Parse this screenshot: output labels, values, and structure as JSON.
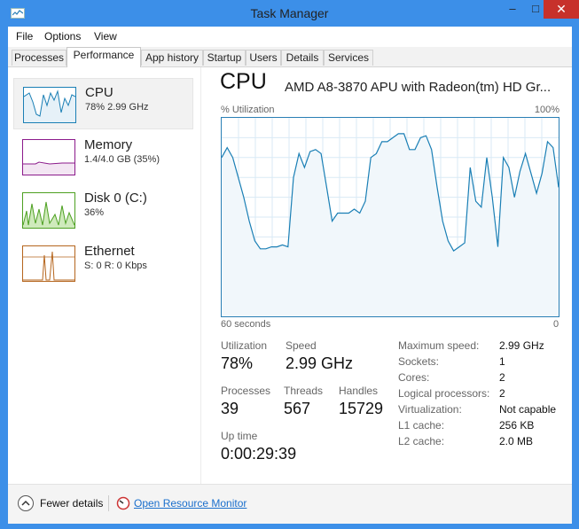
{
  "window": {
    "title": "Task Manager",
    "minimize": "–",
    "maximize": "□",
    "close": "✕"
  },
  "menu": [
    "File",
    "Options",
    "View"
  ],
  "tabs": [
    "Processes",
    "Performance",
    "App history",
    "Startup",
    "Users",
    "Details",
    "Services"
  ],
  "active_tab": "Performance",
  "sidebar": [
    {
      "title": "CPU",
      "sub": "78% 2.99 GHz",
      "color": "#1a7fb5"
    },
    {
      "title": "Memory",
      "sub": "1.4/4.0 GB (35%)",
      "color": "#8b1a8b"
    },
    {
      "title": "Disk 0 (C:)",
      "sub": "36%",
      "color": "#4da021"
    },
    {
      "title": "Ethernet",
      "sub": "S: 0 R: 0 Kbps",
      "color": "#b5651d"
    }
  ],
  "main": {
    "title": "CPU",
    "processor": "AMD A8-3870 APU with Radeon(tm) HD Gr...",
    "util_label": "% Utilization",
    "util_max": "100%",
    "time_label": "60 seconds",
    "time_zero": "0"
  },
  "chart_data": {
    "type": "area",
    "ylim": [
      0,
      100
    ],
    "x_range": [
      60,
      0
    ],
    "values": [
      80,
      85,
      80,
      70,
      60,
      48,
      38,
      34,
      34,
      35,
      35,
      36,
      35,
      70,
      82,
      75,
      83,
      84,
      82,
      65,
      48,
      52,
      52,
      52,
      54,
      52,
      58,
      80,
      82,
      88,
      88,
      90,
      92,
      92,
      84,
      84,
      90,
      91,
      84,
      65,
      48,
      38,
      33,
      35,
      37,
      75,
      58,
      55,
      80,
      60,
      35,
      80,
      75,
      60,
      73,
      82,
      72,
      62,
      72,
      88,
      85,
      65
    ],
    "grid": true
  },
  "stats": {
    "utilization_label": "Utilization",
    "utilization": "78%",
    "speed_label": "Speed",
    "speed": "2.99 GHz",
    "processes_label": "Processes",
    "processes": "39",
    "threads_label": "Threads",
    "threads": "567",
    "handles_label": "Handles",
    "handles": "15729",
    "uptime_label": "Up time",
    "uptime": "0:00:29:39"
  },
  "specs": [
    {
      "label": "Maximum speed:",
      "value": "2.99 GHz"
    },
    {
      "label": "Sockets:",
      "value": "1"
    },
    {
      "label": "Cores:",
      "value": "2"
    },
    {
      "label": "Logical processors:",
      "value": "2"
    },
    {
      "label": "Virtualization:",
      "value": "Not capable"
    },
    {
      "label": "L1 cache:",
      "value": "256 KB"
    },
    {
      "label": "L2 cache:",
      "value": "2.0 MB"
    }
  ],
  "footer": {
    "fewer": "Fewer details",
    "resource_monitor": "Open Resource Monitor"
  },
  "icons": {
    "fewer": "chevron-up-icon",
    "resource_monitor": "resource-monitor-icon"
  }
}
